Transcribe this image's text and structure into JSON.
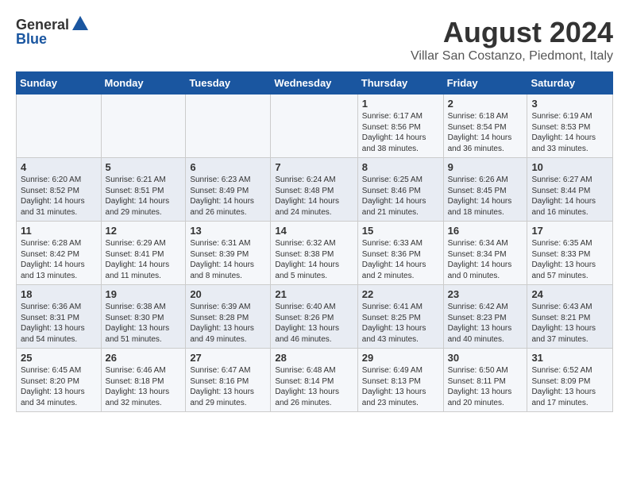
{
  "header": {
    "logo_general": "General",
    "logo_blue": "Blue",
    "month_title": "August 2024",
    "location": "Villar San Costanzo, Piedmont, Italy"
  },
  "days_of_week": [
    "Sunday",
    "Monday",
    "Tuesday",
    "Wednesday",
    "Thursday",
    "Friday",
    "Saturday"
  ],
  "weeks": [
    [
      {
        "day": "",
        "content": ""
      },
      {
        "day": "",
        "content": ""
      },
      {
        "day": "",
        "content": ""
      },
      {
        "day": "",
        "content": ""
      },
      {
        "day": "1",
        "content": "Sunrise: 6:17 AM\nSunset: 8:56 PM\nDaylight: 14 hours and 38 minutes."
      },
      {
        "day": "2",
        "content": "Sunrise: 6:18 AM\nSunset: 8:54 PM\nDaylight: 14 hours and 36 minutes."
      },
      {
        "day": "3",
        "content": "Sunrise: 6:19 AM\nSunset: 8:53 PM\nDaylight: 14 hours and 33 minutes."
      }
    ],
    [
      {
        "day": "4",
        "content": "Sunrise: 6:20 AM\nSunset: 8:52 PM\nDaylight: 14 hours and 31 minutes."
      },
      {
        "day": "5",
        "content": "Sunrise: 6:21 AM\nSunset: 8:51 PM\nDaylight: 14 hours and 29 minutes."
      },
      {
        "day": "6",
        "content": "Sunrise: 6:23 AM\nSunset: 8:49 PM\nDaylight: 14 hours and 26 minutes."
      },
      {
        "day": "7",
        "content": "Sunrise: 6:24 AM\nSunset: 8:48 PM\nDaylight: 14 hours and 24 minutes."
      },
      {
        "day": "8",
        "content": "Sunrise: 6:25 AM\nSunset: 8:46 PM\nDaylight: 14 hours and 21 minutes."
      },
      {
        "day": "9",
        "content": "Sunrise: 6:26 AM\nSunset: 8:45 PM\nDaylight: 14 hours and 18 minutes."
      },
      {
        "day": "10",
        "content": "Sunrise: 6:27 AM\nSunset: 8:44 PM\nDaylight: 14 hours and 16 minutes."
      }
    ],
    [
      {
        "day": "11",
        "content": "Sunrise: 6:28 AM\nSunset: 8:42 PM\nDaylight: 14 hours and 13 minutes."
      },
      {
        "day": "12",
        "content": "Sunrise: 6:29 AM\nSunset: 8:41 PM\nDaylight: 14 hours and 11 minutes."
      },
      {
        "day": "13",
        "content": "Sunrise: 6:31 AM\nSunset: 8:39 PM\nDaylight: 14 hours and 8 minutes."
      },
      {
        "day": "14",
        "content": "Sunrise: 6:32 AM\nSunset: 8:38 PM\nDaylight: 14 hours and 5 minutes."
      },
      {
        "day": "15",
        "content": "Sunrise: 6:33 AM\nSunset: 8:36 PM\nDaylight: 14 hours and 2 minutes."
      },
      {
        "day": "16",
        "content": "Sunrise: 6:34 AM\nSunset: 8:34 PM\nDaylight: 14 hours and 0 minutes."
      },
      {
        "day": "17",
        "content": "Sunrise: 6:35 AM\nSunset: 8:33 PM\nDaylight: 13 hours and 57 minutes."
      }
    ],
    [
      {
        "day": "18",
        "content": "Sunrise: 6:36 AM\nSunset: 8:31 PM\nDaylight: 13 hours and 54 minutes."
      },
      {
        "day": "19",
        "content": "Sunrise: 6:38 AM\nSunset: 8:30 PM\nDaylight: 13 hours and 51 minutes."
      },
      {
        "day": "20",
        "content": "Sunrise: 6:39 AM\nSunset: 8:28 PM\nDaylight: 13 hours and 49 minutes."
      },
      {
        "day": "21",
        "content": "Sunrise: 6:40 AM\nSunset: 8:26 PM\nDaylight: 13 hours and 46 minutes."
      },
      {
        "day": "22",
        "content": "Sunrise: 6:41 AM\nSunset: 8:25 PM\nDaylight: 13 hours and 43 minutes."
      },
      {
        "day": "23",
        "content": "Sunrise: 6:42 AM\nSunset: 8:23 PM\nDaylight: 13 hours and 40 minutes."
      },
      {
        "day": "24",
        "content": "Sunrise: 6:43 AM\nSunset: 8:21 PM\nDaylight: 13 hours and 37 minutes."
      }
    ],
    [
      {
        "day": "25",
        "content": "Sunrise: 6:45 AM\nSunset: 8:20 PM\nDaylight: 13 hours and 34 minutes."
      },
      {
        "day": "26",
        "content": "Sunrise: 6:46 AM\nSunset: 8:18 PM\nDaylight: 13 hours and 32 minutes."
      },
      {
        "day": "27",
        "content": "Sunrise: 6:47 AM\nSunset: 8:16 PM\nDaylight: 13 hours and 29 minutes."
      },
      {
        "day": "28",
        "content": "Sunrise: 6:48 AM\nSunset: 8:14 PM\nDaylight: 13 hours and 26 minutes."
      },
      {
        "day": "29",
        "content": "Sunrise: 6:49 AM\nSunset: 8:13 PM\nDaylight: 13 hours and 23 minutes."
      },
      {
        "day": "30",
        "content": "Sunrise: 6:50 AM\nSunset: 8:11 PM\nDaylight: 13 hours and 20 minutes."
      },
      {
        "day": "31",
        "content": "Sunrise: 6:52 AM\nSunset: 8:09 PM\nDaylight: 13 hours and 17 minutes."
      }
    ]
  ]
}
